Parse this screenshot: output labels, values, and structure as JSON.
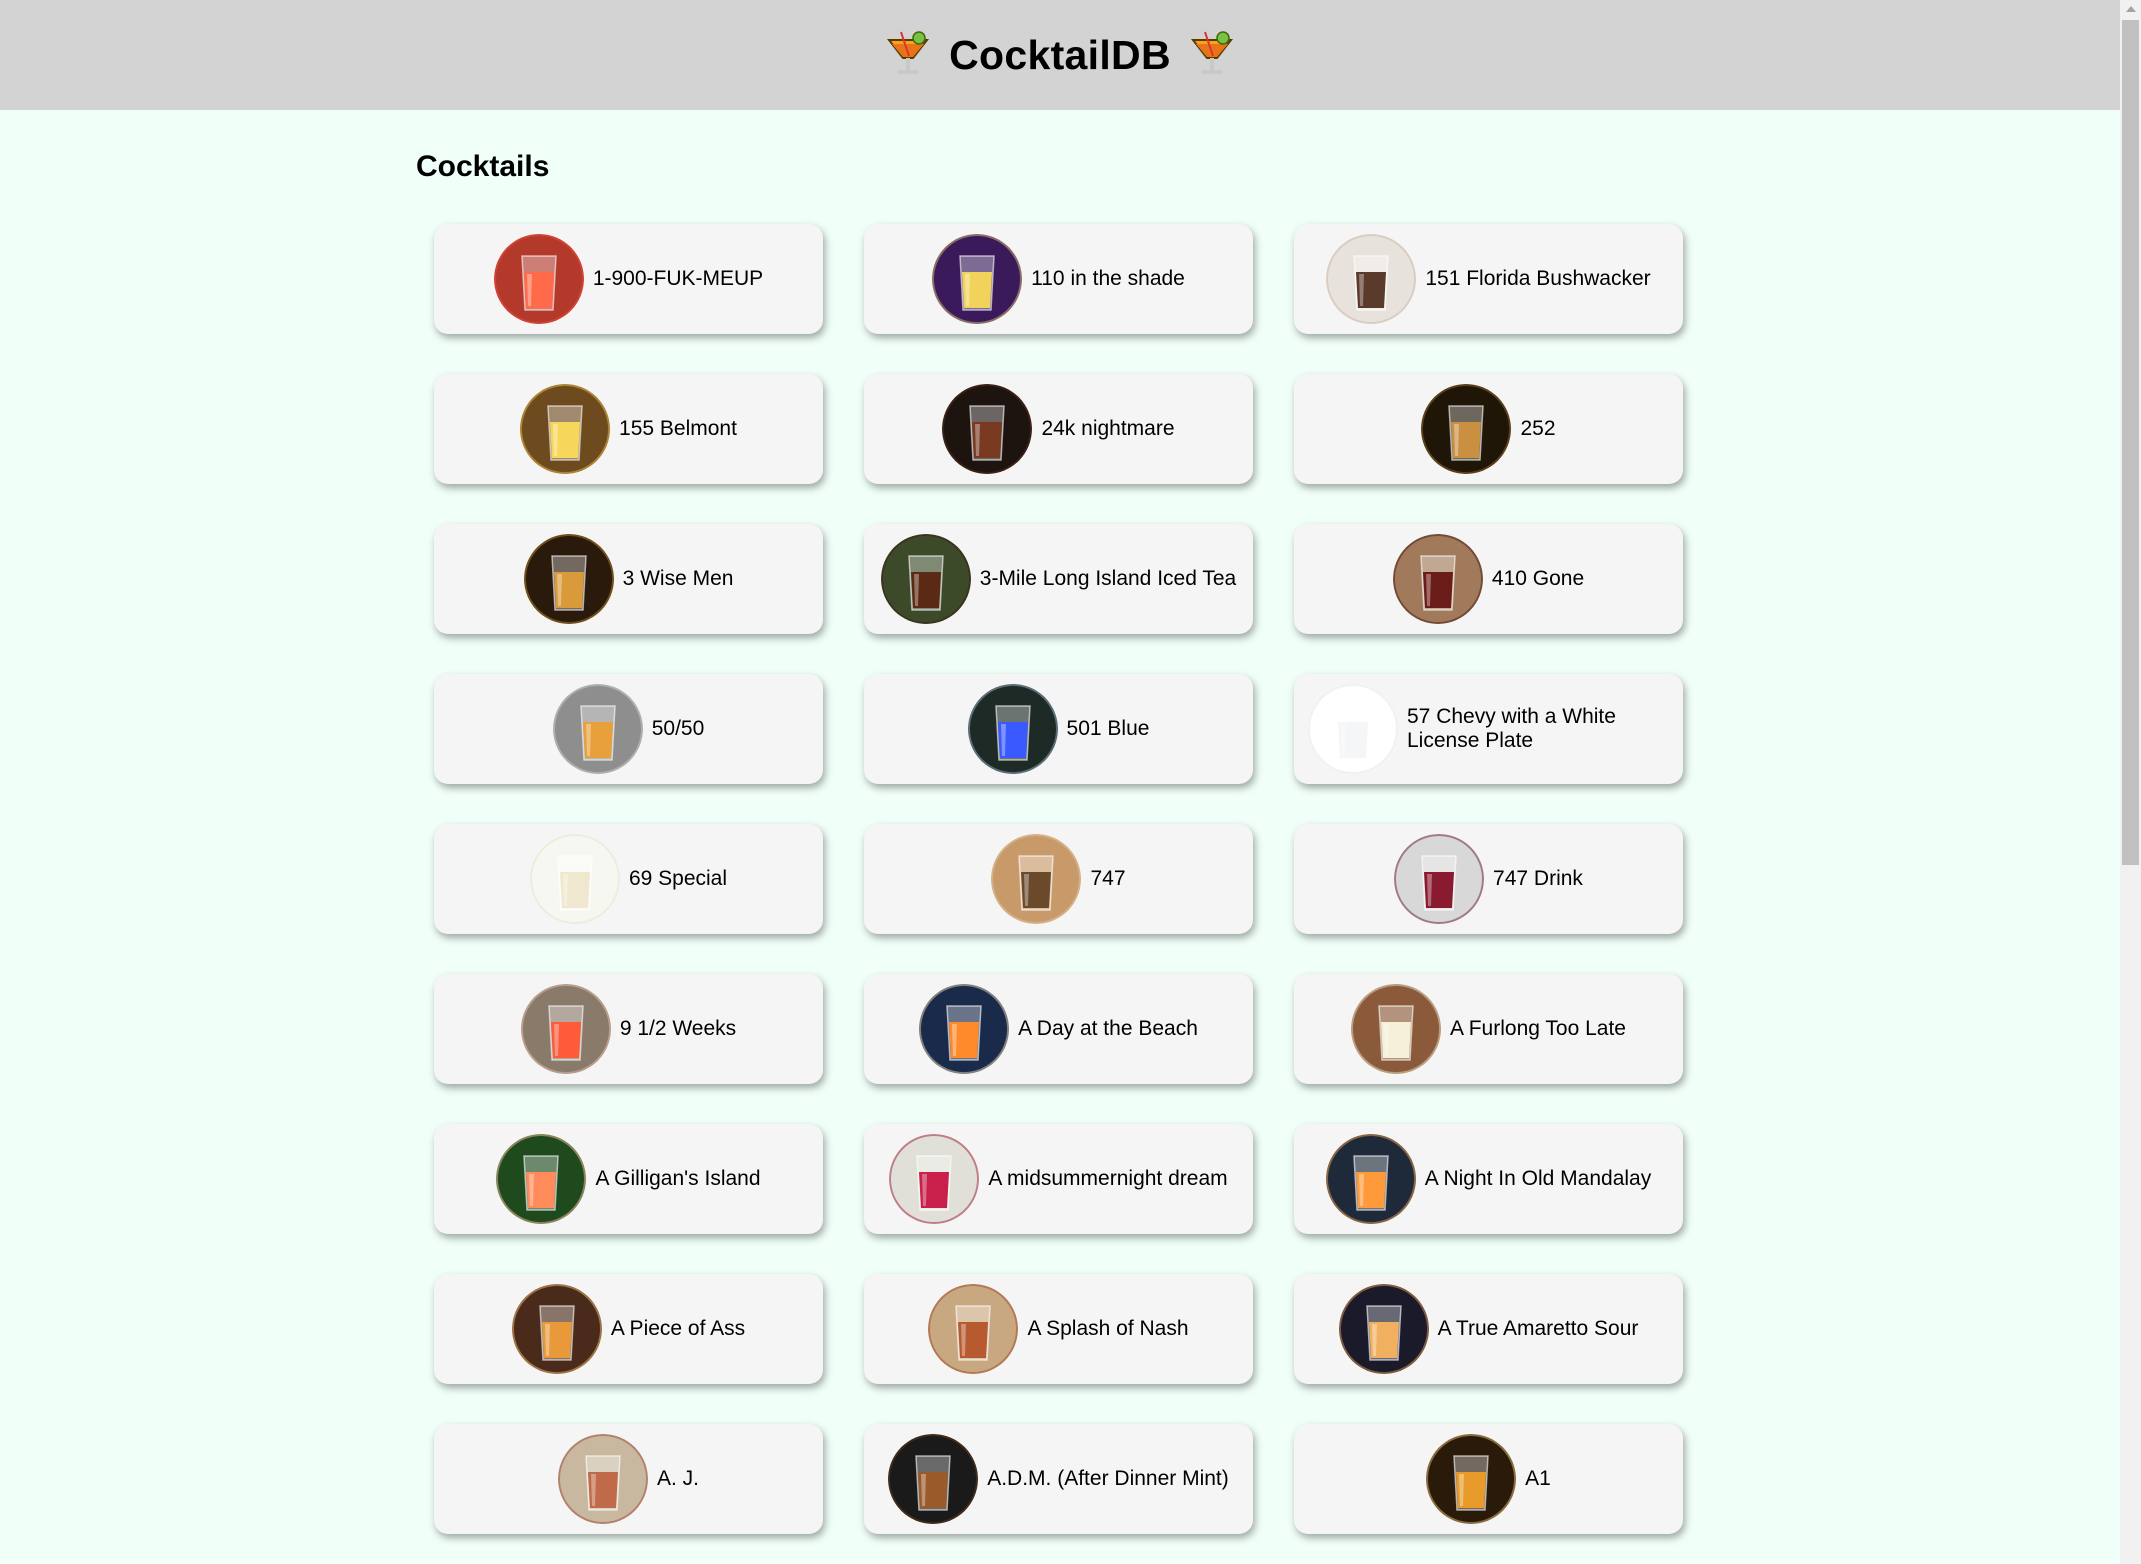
{
  "header": {
    "title": "CocktailDB",
    "left_icon": "tropical-drink-icon",
    "right_icon": "tropical-drink-icon",
    "background": "#d3d3d3"
  },
  "page": {
    "background": "#f0fff8",
    "section_title": "Cocktails"
  },
  "cocktails": [
    {
      "name": "1-900-FUK-MEUP",
      "bg": "#b33a2b",
      "glass": "#f24a3a",
      "liquid": "#ff6b4a"
    },
    {
      "name": "110 in the shade",
      "bg": "#3b1a5c",
      "glass": "#d9c36a",
      "liquid": "#f1d35c"
    },
    {
      "name": "151 Florida Bushwacker",
      "bg": "#e8e2dc",
      "glass": "#c9b8a8",
      "liquid": "#5a3a2a"
    },
    {
      "name": "155 Belmont",
      "bg": "#6e4a1f",
      "glass": "#e9c04a",
      "liquid": "#f6d75a"
    },
    {
      "name": "24k nightmare",
      "bg": "#1d1410",
      "glass": "#5a2d1a",
      "liquid": "#7a3a22"
    },
    {
      "name": "252",
      "bg": "#1f1608",
      "glass": "#9a6a2a",
      "liquid": "#c89040"
    },
    {
      "name": "3 Wise Men",
      "bg": "#2a1a0c",
      "glass": "#b8832d",
      "liquid": "#d99a3a"
    },
    {
      "name": "3-Mile Long Island Iced Tea",
      "bg": "#3d4a2a",
      "glass": "#3a1e12",
      "liquid": "#5a2a14"
    },
    {
      "name": "410 Gone",
      "bg": "#a07a5a",
      "glass": "#4a1a14",
      "liquid": "#6a1c18"
    },
    {
      "name": "50/50",
      "bg": "#8e8e8e",
      "glass": "#d0d0d0",
      "liquid": "#e8a03a"
    },
    {
      "name": "501 Blue",
      "bg": "#1e2a26",
      "glass": "#9ab0c8",
      "liquid": "#3a5aff"
    },
    {
      "name": "57 Chevy with a White License Plate",
      "bg": "#ffffff",
      "glass": "#e0e6ea",
      "liquid": "#f4f6f8"
    },
    {
      "name": "69 Special",
      "bg": "#f7f7f2",
      "glass": "#e8e2c8",
      "liquid": "#efe8cf"
    },
    {
      "name": "747",
      "bg": "#c89a6a",
      "glass": "#e0c8a8",
      "liquid": "#6a4a2a"
    },
    {
      "name": "747 Drink",
      "bg": "#d8d8d8",
      "glass": "#6a1a2a",
      "liquid": "#8a1a30"
    },
    {
      "name": "9 1/2 Weeks",
      "bg": "#8a7a6a",
      "glass": "#e8c0b0",
      "liquid": "#ff5a3a"
    },
    {
      "name": "A Day at the Beach",
      "bg": "#1a2a4a",
      "glass": "#f0d8b0",
      "liquid": "#ff8a2a"
    },
    {
      "name": "A Furlong Too Late",
      "bg": "#8a5a3a",
      "glass": "#e8e0c8",
      "liquid": "#f6f0d8"
    },
    {
      "name": "A Gilligan's Island",
      "bg": "#1e4a1e",
      "glass": "#f8c0a0",
      "liquid": "#ff8a5a"
    },
    {
      "name": "A midsummernight dream",
      "bg": "#e0e0d8",
      "glass": "#a01a3a",
      "liquid": "#c8204a"
    },
    {
      "name": "A Night In Old Mandalay",
      "bg": "#1e2a3a",
      "glass": "#f0a050",
      "liquid": "#ff9a3a"
    },
    {
      "name": "A Piece of Ass",
      "bg": "#4a2a1a",
      "glass": "#f0c070",
      "liquid": "#e89a3a"
    },
    {
      "name": "A Splash of Nash",
      "bg": "#c8a880",
      "glass": "#a04a2a",
      "liquid": "#b85a30"
    },
    {
      "name": "A True Amaretto Sour",
      "bg": "#1a1a2a",
      "glass": "#e0a050",
      "liquid": "#f0b060"
    },
    {
      "name": "A. J.",
      "bg": "#c8b8a0",
      "glass": "#a04a3a",
      "liquid": "#c06a4a"
    },
    {
      "name": "A.D.M. (After Dinner Mint)",
      "bg": "#1a1a1a",
      "glass": "#6a3a1a",
      "liquid": "#9a5a2a"
    },
    {
      "name": "A1",
      "bg": "#2a1a0a",
      "glass": "#e8c070",
      "liquid": "#e89a2a"
    }
  ]
}
